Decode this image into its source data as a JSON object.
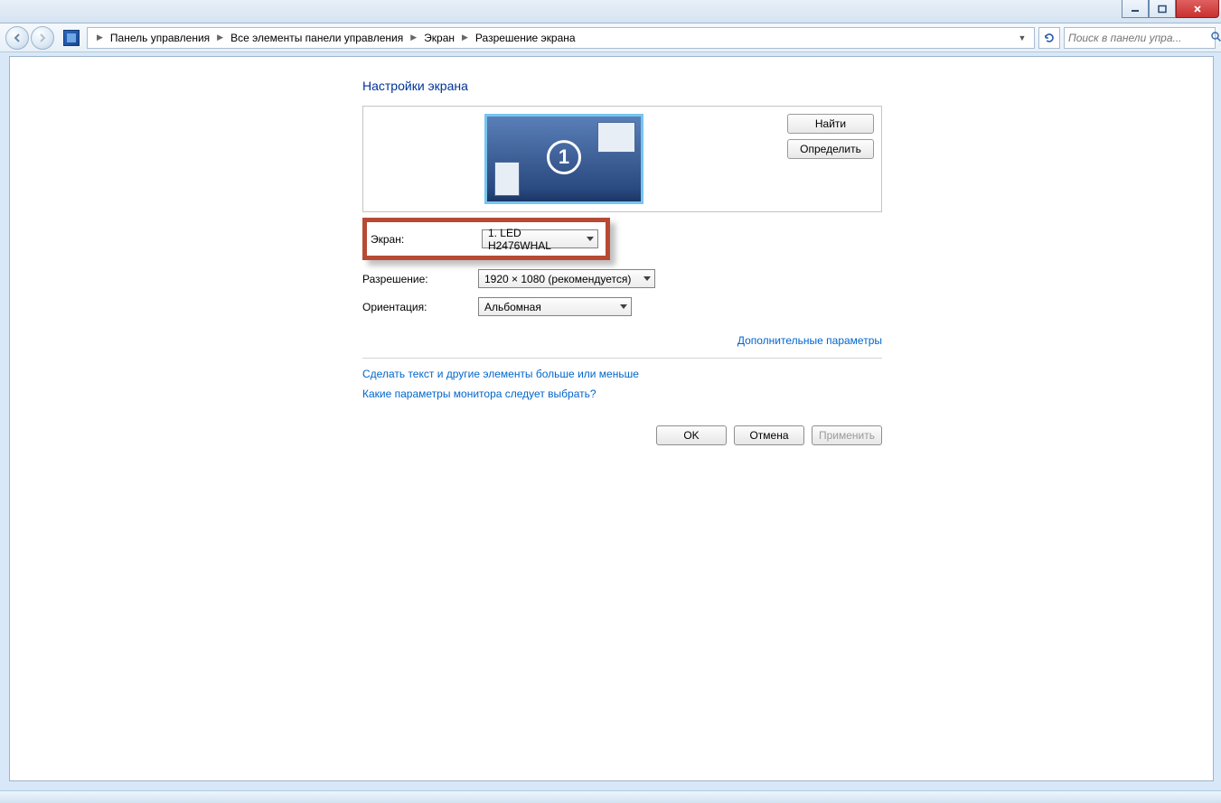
{
  "window_controls": {
    "minimize": "min",
    "maximize": "max",
    "close": "close"
  },
  "breadcrumb": {
    "items": [
      "Панель управления",
      "Все элементы панели управления",
      "Экран",
      "Разрешение экрана"
    ]
  },
  "search": {
    "placeholder": "Поиск в панели упра..."
  },
  "page": {
    "title": "Настройки экрана",
    "monitor_number": "1",
    "find_btn": "Найти",
    "identify_btn": "Определить",
    "fields": {
      "screen_label": "Экран:",
      "screen_value": "1. LED H2476WHAL",
      "resolution_label": "Разрешение:",
      "resolution_value": "1920 × 1080 (рекомендуется)",
      "orientation_label": "Ориентация:",
      "orientation_value": "Альбомная"
    },
    "advanced_link": "Дополнительные параметры",
    "help1": "Сделать текст и другие элементы больше или меньше",
    "help2": "Какие параметры монитора следует выбрать?",
    "ok": "OK",
    "cancel": "Отмена",
    "apply": "Применить"
  }
}
